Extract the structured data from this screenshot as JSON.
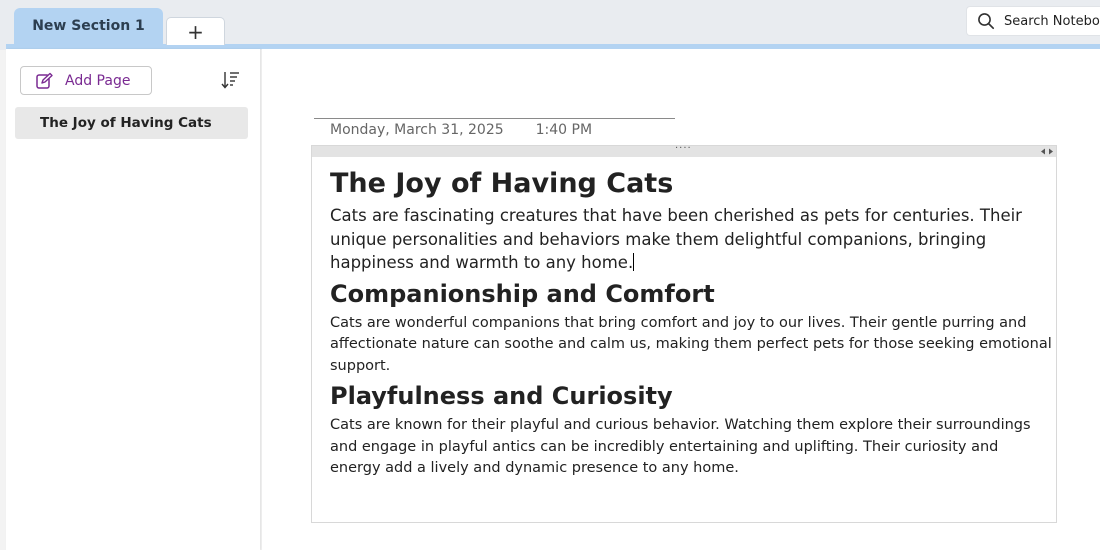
{
  "sections": {
    "active_tab": "New Section 1",
    "add_tab_label": "+"
  },
  "search": {
    "placeholder": "Search Notebooks"
  },
  "page_list": {
    "add_page_label": "Add Page",
    "items": [
      {
        "title": "The Joy of Having Cats"
      }
    ]
  },
  "page": {
    "date": "Monday, March 31, 2025",
    "time": "1:40 PM",
    "title": "The Joy of Having Cats",
    "intro": "Cats are fascinating creatures that have been cherished as pets for centuries. Their unique personalities and behaviors make them delightful companions, bringing happiness and warmth to any home.",
    "sections": [
      {
        "heading": "Companionship and Comfort",
        "body": "Cats are wonderful companions that bring comfort and joy to our lives. Their gentle purring and affectionate nature can soothe and calm us, making them perfect pets for those seeking emotional support."
      },
      {
        "heading": "Playfulness and Curiosity",
        "body": "Cats are known for their playful and curious behavior. Watching them explore their surroundings and engage in playful antics can be incredibly entertaining and uplifting. Their curiosity and energy add a lively and dynamic presence to any home."
      }
    ]
  },
  "colors": {
    "section_tab": "#b3d3f2",
    "accent_purple": "#7a2a92",
    "selected_page": "#e8e8e8"
  },
  "icons": {
    "search": "search-icon",
    "add_page": "edit-icon",
    "sort": "sort-icon",
    "container_move": "drag-handle-icon",
    "container_resize": "resize-arrows-icon"
  }
}
